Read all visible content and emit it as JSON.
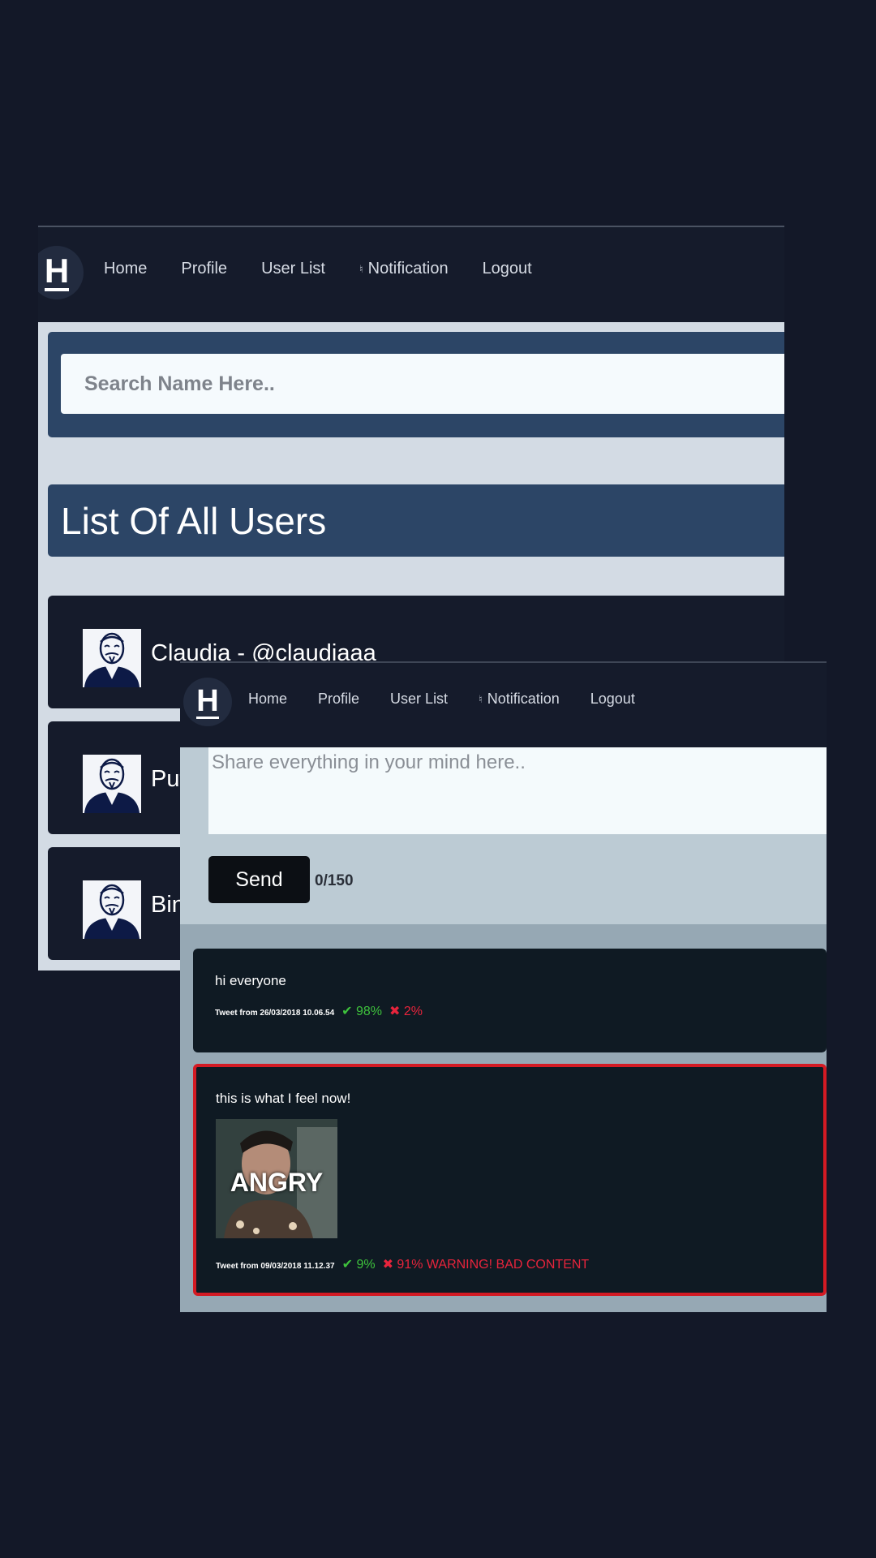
{
  "user_list_screen": {
    "nav": {
      "logo": "H",
      "links": [
        "Home",
        "Profile",
        "User List",
        "Notification",
        "Logout"
      ]
    },
    "search": {
      "placeholder": "Search Name Here.."
    },
    "list_title": "List Of All Users",
    "users": [
      {
        "name": "Claudia - @claudiaaa"
      },
      {
        "name": "Put"
      },
      {
        "name": "Bin"
      }
    ]
  },
  "feed_screen": {
    "nav": {
      "logo": "H",
      "links": [
        "Home",
        "Profile",
        "User List",
        "Notification",
        "Logout"
      ]
    },
    "composer": {
      "placeholder": "Share everything in your mind here..",
      "send_label": "Send",
      "char_count": "0/150"
    },
    "tweets": [
      {
        "text": "hi everyone",
        "date": "Tweet from 26/03/2018 10.06.54",
        "good": "98%",
        "bad": "2%",
        "warning": ""
      },
      {
        "text": "this is what I feel now!",
        "image_caption": "ANGRY",
        "date": "Tweet from 09/03/2018 11.12.37",
        "good": "9%",
        "bad": "91% WARNING! BAD CONTENT"
      }
    ]
  },
  "colors": {
    "background": "#131828",
    "nav": "#151b2b",
    "band": "#2c4566",
    "good": "#3ec23c",
    "bad": "#e8243c",
    "warning_border": "#d41a23"
  }
}
